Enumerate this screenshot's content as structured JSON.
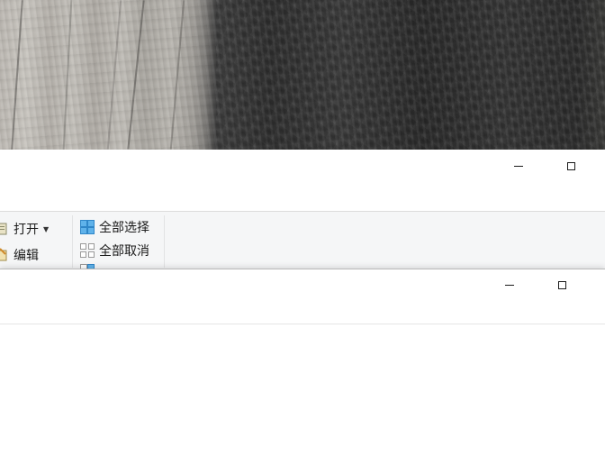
{
  "desktop": {
    "wallpaper_description_icon": "rock-cliff-wallpaper"
  },
  "back_window": {
    "controls": {
      "minimize_icon": "minimize-icon",
      "maximize_icon": "maximize-icon"
    },
    "ribbon": {
      "open_label": "打开",
      "edit_label": "编辑",
      "select_all_label": "全部选择",
      "select_none_label": "全部取消",
      "open_dropdown_icon": "caret-down-icon"
    }
  },
  "front_window": {
    "controls": {
      "minimize_icon": "minimize-icon",
      "maximize_icon": "maximize-icon"
    }
  },
  "colors": {
    "ribbon_bg": "#f5f6f7",
    "select_icon_blue": "#3c9ee0",
    "window_bg": "#ffffff"
  }
}
